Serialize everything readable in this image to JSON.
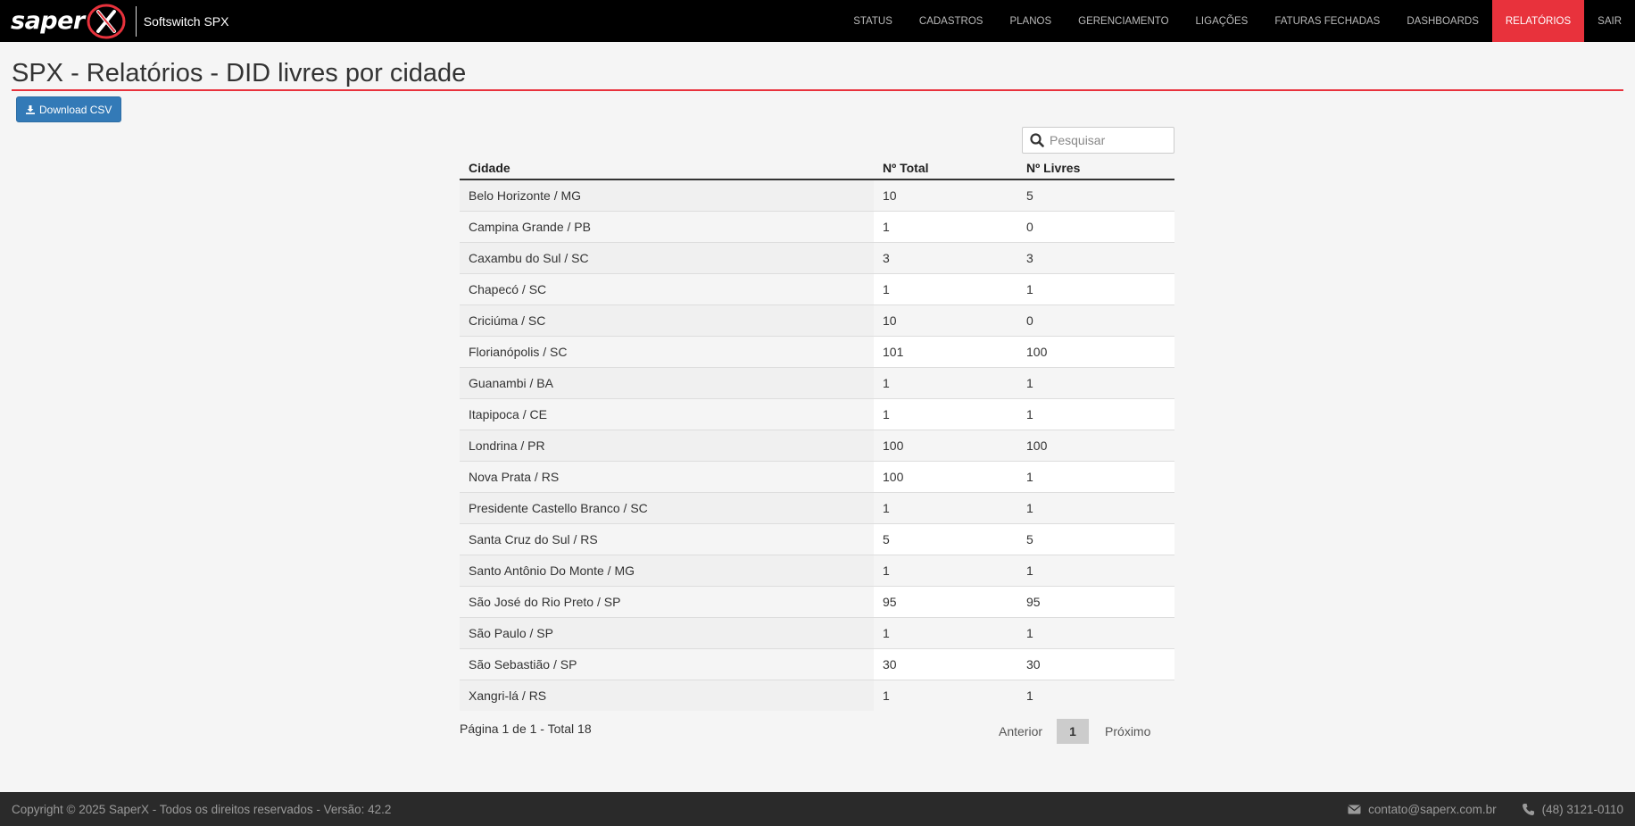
{
  "brand": {
    "logo_text": "saper",
    "app_name": "Softswitch SPX"
  },
  "nav": {
    "items": [
      {
        "label": "STATUS"
      },
      {
        "label": "CADASTROS"
      },
      {
        "label": "PLANOS"
      },
      {
        "label": "GERENCIAMENTO"
      },
      {
        "label": "LIGAÇÕES"
      },
      {
        "label": "FATURAS FECHADAS"
      },
      {
        "label": "DASHBOARDS"
      },
      {
        "label": "RELATÓRIOS",
        "active": true
      },
      {
        "label": "SAIR"
      }
    ]
  },
  "page": {
    "title": "SPX - Relatórios - DID livres por cidade",
    "download_label": "Download CSV"
  },
  "search": {
    "placeholder": "Pesquisar",
    "value": ""
  },
  "table": {
    "headers": {
      "city": "Cidade",
      "total": "Nº Total",
      "free": "Nº Livres"
    },
    "rows": [
      {
        "city": "Belo Horizonte / MG",
        "total": "10",
        "free": "5"
      },
      {
        "city": "Campina Grande / PB",
        "total": "1",
        "free": "0"
      },
      {
        "city": "Caxambu do Sul / SC",
        "total": "3",
        "free": "3"
      },
      {
        "city": "Chapecó / SC",
        "total": "1",
        "free": "1"
      },
      {
        "city": "Criciúma / SC",
        "total": "10",
        "free": "0"
      },
      {
        "city": "Florianópolis / SC",
        "total": "101",
        "free": "100"
      },
      {
        "city": "Guanambi / BA",
        "total": "1",
        "free": "1"
      },
      {
        "city": "Itapipoca / CE",
        "total": "1",
        "free": "1"
      },
      {
        "city": "Londrina / PR",
        "total": "100",
        "free": "100"
      },
      {
        "city": "Nova Prata / RS",
        "total": "100",
        "free": "1"
      },
      {
        "city": "Presidente Castello Branco / SC",
        "total": "1",
        "free": "1"
      },
      {
        "city": "Santa Cruz do Sul / RS",
        "total": "5",
        "free": "5"
      },
      {
        "city": "Santo Antônio Do Monte / MG",
        "total": "1",
        "free": "1"
      },
      {
        "city": "São José do Rio Preto / SP",
        "total": "95",
        "free": "95"
      },
      {
        "city": "São Paulo / SP",
        "total": "1",
        "free": "1"
      },
      {
        "city": "São Sebastião / SP",
        "total": "30",
        "free": "30"
      },
      {
        "city": "Xangri-lá / RS",
        "total": "1",
        "free": "1"
      }
    ]
  },
  "pagination": {
    "info": "Página 1 de 1 - Total 18",
    "prev_label": "Anterior",
    "current_page": "1",
    "next_label": "Próximo"
  },
  "footer": {
    "copyright": "Copyright © 2025 SaperX - Todos os direitos reservados - Versão: 42.2",
    "email": "contato@saperx.com.br",
    "phone": "(48) 3121-0110"
  },
  "colors": {
    "accent": "#e8323c",
    "primary_button": "#337ab7",
    "navbar": "#000000",
    "footer": "#2a2a2a"
  },
  "icons": {
    "download": "download-icon",
    "search": "search-icon",
    "email": "envelope-icon",
    "phone": "phone-icon"
  }
}
